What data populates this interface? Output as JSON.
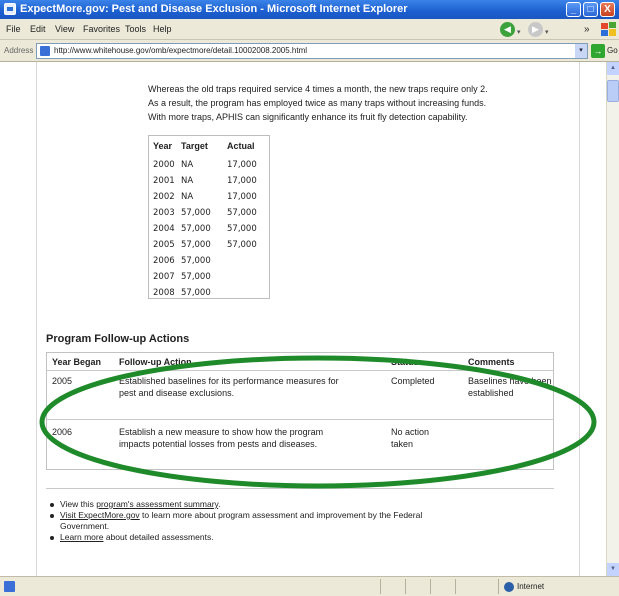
{
  "window": {
    "title": "ExpectMore.gov: Pest and Disease Exclusion - Microsoft Internet Explorer",
    "controls": {
      "minimize": "_",
      "maximize": "□",
      "close": "X"
    }
  },
  "menu": {
    "items": [
      "File",
      "Edit",
      "View",
      "Favorites",
      "Tools",
      "Help"
    ],
    "back_glyph": "◀",
    "forward_glyph": "▶",
    "dropdown_glyph": "▾",
    "overflow": "»"
  },
  "address": {
    "label": "Address",
    "url": "http://www.whitehouse.gov/omb/expectmore/detail.10002008.2005.html",
    "go_label": "Go",
    "go_glyph": "→",
    "dropdown_glyph": "▾"
  },
  "content": {
    "paragraph_lines": [
      "Whereas the old traps required service 4 times a month, the new traps require only 2.",
      "As a result, the program has employed twice as many traps without increasing funds.",
      "With more traps, APHIS can significantly enhance its fruit fly detection capability."
    ],
    "measure_table": {
      "headers": [
        "Year",
        "Target",
        "Actual"
      ],
      "rows": [
        [
          "2000",
          "NA",
          "17,000"
        ],
        [
          "2001",
          "NA",
          "17,000"
        ],
        [
          "2002",
          "NA",
          "17,000"
        ],
        [
          "2003",
          "57,000",
          "57,000"
        ],
        [
          "2004",
          "57,000",
          "57,000"
        ],
        [
          "2005",
          "57,000",
          "57,000"
        ],
        [
          "2006",
          "57,000",
          ""
        ],
        [
          "2007",
          "57,000",
          ""
        ],
        [
          "2008",
          "57,000",
          ""
        ]
      ]
    },
    "followup": {
      "title": "Program Follow-up Actions",
      "headers": [
        "Year Began",
        "Follow-up Action",
        "Status",
        "Comments"
      ],
      "rows": [
        {
          "year": "2005",
          "action_lines": [
            "Established baselines for its performance measures for",
            "pest and disease exclusions."
          ],
          "status_lines": [
            "Completed"
          ],
          "comments_lines": [
            "Baselines have been",
            "established"
          ]
        },
        {
          "year": "2006",
          "action_lines": [
            "Establish a new measure to show how the program",
            "impacts potential losses from pests and diseases."
          ],
          "status_lines": [
            "No action",
            "taken"
          ],
          "comments_lines": []
        }
      ]
    },
    "links": {
      "item1_pre": "View this ",
      "item1_link": "program's assessment summary",
      "item1_post": ".",
      "item2_link": "Visit ExpectMore.gov",
      "item2_post": " to learn more about program assessment and improvement by the Federal",
      "item2_cont": "Government.",
      "item3_link": "Learn more",
      "item3_post": " about detailed assessments."
    }
  },
  "status": {
    "zone": "Internet"
  },
  "colors": {
    "title_bar": "#1c5fd0",
    "annotation_ellipse": "#1f8a2a",
    "chrome_bg": "#ece9d8"
  }
}
